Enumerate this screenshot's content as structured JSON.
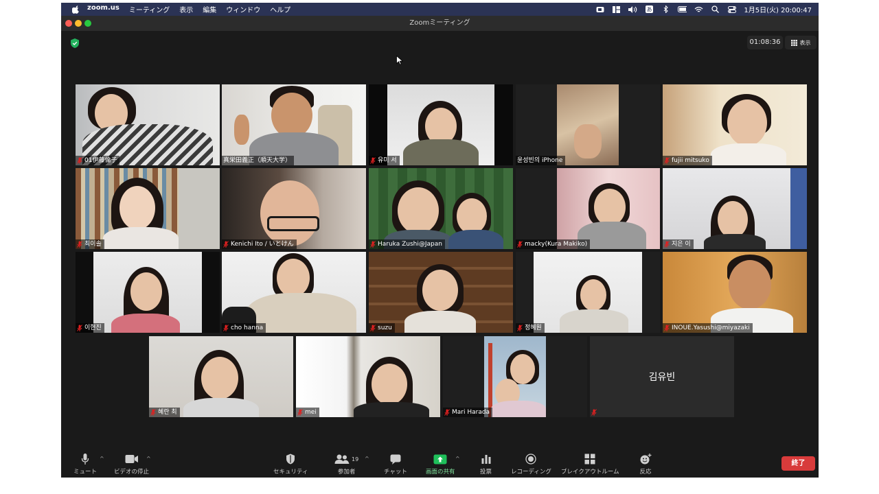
{
  "menubar": {
    "app_name": "zoom.us",
    "menus": [
      "ミーティング",
      "表示",
      "編集",
      "ウィンドウ",
      "ヘルプ"
    ],
    "datetime": "1月5日(火) 20:00:47"
  },
  "window": {
    "title": "Zoomミーティング",
    "timer": "01:08:36",
    "view_label": "表示"
  },
  "participants": [
    {
      "name": "01伊藤倫子",
      "muted": true
    },
    {
      "name": "真栄田義正（順天大学）",
      "muted": false,
      "active_speaker": true
    },
    {
      "name": "유미 서",
      "muted": true
    },
    {
      "name": "윤성빈의 iPhone",
      "muted": false
    },
    {
      "name": "fujii mitsuko",
      "muted": true
    },
    {
      "name": "최이솔",
      "muted": true
    },
    {
      "name": "Kenichi Ito / いとけん",
      "muted": true
    },
    {
      "name": "Haruka Zushi@Japan",
      "muted": true
    },
    {
      "name": "macky(Kura Makiko)",
      "muted": true
    },
    {
      "name": "지은 이",
      "muted": true
    },
    {
      "name": "이현진",
      "muted": true
    },
    {
      "name": "cho hanna",
      "muted": true
    },
    {
      "name": "suzu",
      "muted": true
    },
    {
      "name": "정혜원",
      "muted": true
    },
    {
      "name": "INOUE.Yasushi@miyazaki",
      "muted": true
    },
    {
      "name": "혜란 최",
      "muted": true
    },
    {
      "name": "mei",
      "muted": true
    },
    {
      "name": "Mari Harada",
      "muted": true
    },
    {
      "name": "",
      "muted": true,
      "video_off": true,
      "display_name": "김유빈"
    }
  ],
  "toolbar": {
    "mute": "ミュート",
    "stop_video": "ビデオの停止",
    "security": "セキュリティ",
    "participants": "参加者",
    "participants_count": "19",
    "chat": "チャット",
    "share_screen": "画面の共有",
    "polls": "投票",
    "record": "レコーディング",
    "breakout": "ブレイクアウトルーム",
    "reactions": "反応",
    "end": "終了"
  },
  "colors": {
    "speaker_highlight": "#c4df5b",
    "share_green": "#1fbf5a",
    "end_red": "#d83b3b",
    "muted_red": "#e02020"
  }
}
